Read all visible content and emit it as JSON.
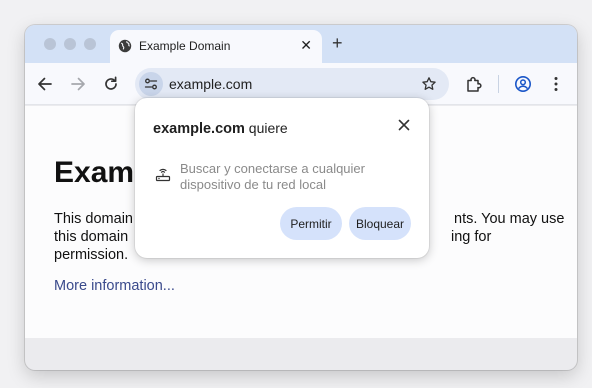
{
  "browser": {
    "tab": {
      "title": "Example Domain",
      "close_glyph": "✕",
      "icon": "globe-icon"
    },
    "new_tab_glyph": "+",
    "address_bar": {
      "url": "example.com"
    }
  },
  "page": {
    "heading": "Examp",
    "paragraph": "This domain                                                  nts. You may use this domain                                               ing for permission.",
    "link": "More information..."
  },
  "permission_prompt": {
    "site": "example.com",
    "verb": "quiere",
    "permission_text": "Buscar y conectarse a cualquier dispositivo de tu red local",
    "allow_label": "Permitir",
    "block_label": "Bloquear"
  },
  "colors": {
    "tabstrip": "#d3e1f6",
    "toolbar": "#f8f9fd",
    "omnibox": "#e3e9f5",
    "button_bg": "#d5e2fb",
    "profile_accent": "#1a56c8",
    "link": "#3a4a8c"
  }
}
